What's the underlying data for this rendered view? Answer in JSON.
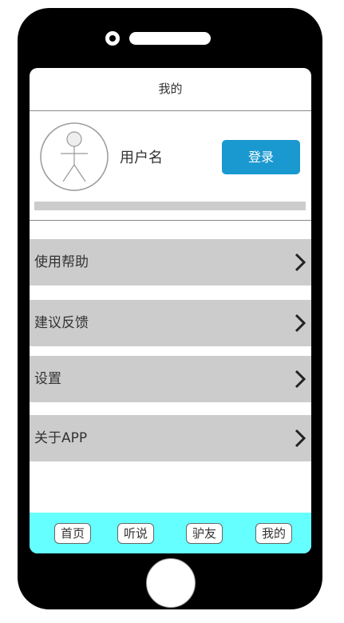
{
  "header": {
    "title": "我的"
  },
  "profile": {
    "username": "用户名",
    "login_label": "登录",
    "login_color": "#1a99d0"
  },
  "menu": {
    "items": [
      {
        "label": "使用帮助",
        "icon": "chevron-right-icon"
      },
      {
        "label": "建议反馈",
        "icon": "chevron-right-icon"
      },
      {
        "label": "设置",
        "icon": "chevron-right-icon"
      },
      {
        "label": "关于APP",
        "icon": "chevron-right-icon"
      }
    ]
  },
  "tabbar": {
    "background": "#66ffff",
    "tabs": [
      {
        "label": "首页"
      },
      {
        "label": "听说"
      },
      {
        "label": "驴友"
      },
      {
        "label": "我的"
      }
    ]
  }
}
